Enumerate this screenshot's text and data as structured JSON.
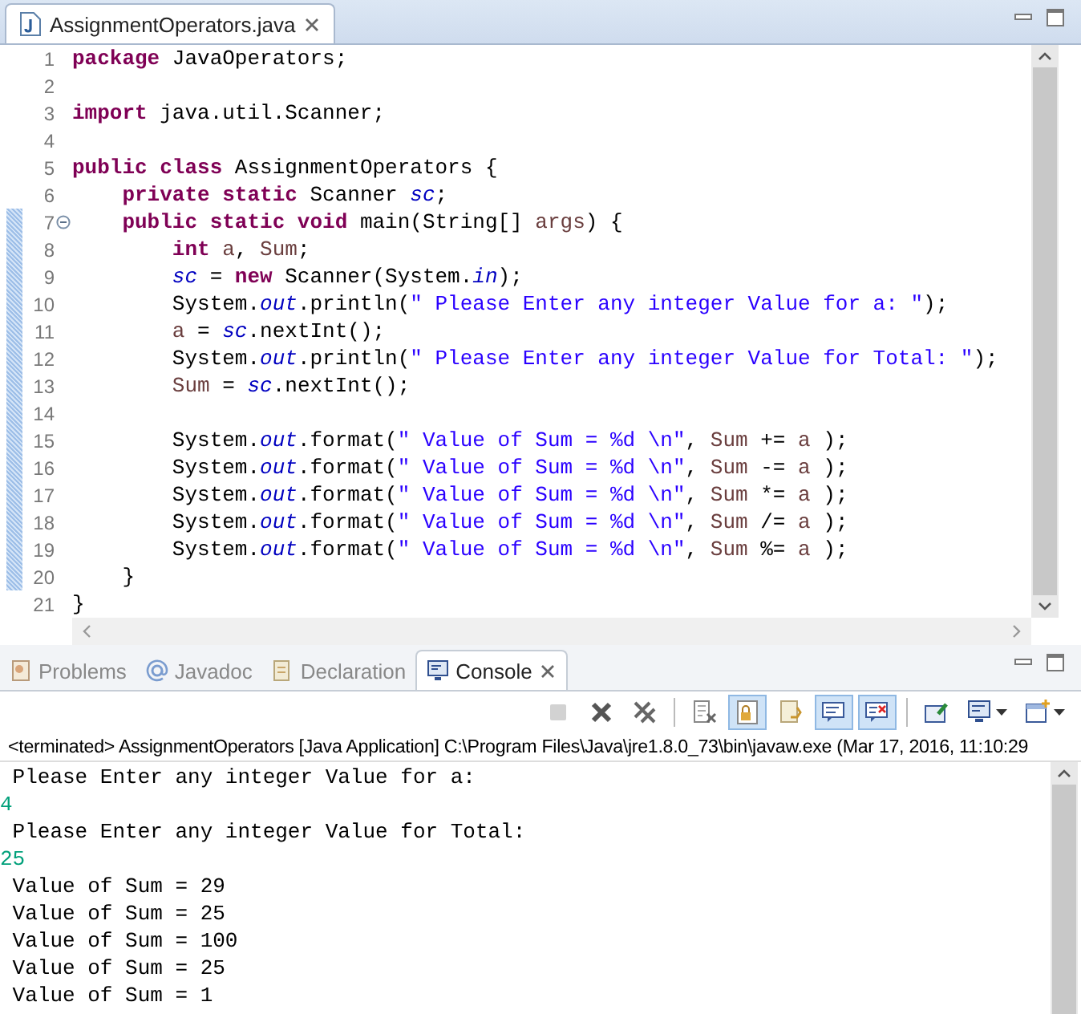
{
  "editor": {
    "tab": {
      "label": "AssignmentOperators.java",
      "selected": true
    },
    "lines": [
      {
        "number": "1",
        "changed": false,
        "collapsible": false,
        "tokens": [
          {
            "kind": "keyword",
            "text": "package"
          },
          {
            "kind": "plain",
            "text": " JavaOperators;"
          }
        ]
      },
      {
        "number": "2",
        "changed": false,
        "collapsible": false
      },
      {
        "number": "3",
        "changed": false,
        "collapsible": false,
        "tokens": [
          {
            "kind": "keyword",
            "text": "import"
          },
          {
            "kind": "plain",
            "text": " java.util.Scanner;"
          }
        ]
      },
      {
        "number": "4",
        "changed": false,
        "collapsible": false
      },
      {
        "number": "5",
        "changed": false,
        "collapsible": false,
        "tokens": [
          {
            "kind": "keyword",
            "text": "public class"
          },
          {
            "kind": "plain",
            "text": " AssignmentOperators {"
          }
        ]
      },
      {
        "number": "6",
        "changed": false,
        "collapsible": false,
        "tokens": [
          {
            "kind": "keyword",
            "text": "    private static"
          },
          {
            "kind": "plain",
            "text": " Scanner "
          },
          {
            "kind": "field",
            "text": "sc"
          },
          {
            "kind": "plain",
            "text": ";"
          }
        ]
      },
      {
        "number": "7",
        "changed": true,
        "collapsible": true,
        "tokens": [
          {
            "kind": "keyword",
            "text": "    public static void"
          },
          {
            "kind": "plain",
            "text": " main(String[] "
          },
          {
            "kind": "variable",
            "text": "args"
          },
          {
            "kind": "plain",
            "text": ") {"
          }
        ]
      },
      {
        "number": "8",
        "changed": true,
        "collapsible": false,
        "tokens": [
          {
            "kind": "keyword",
            "text": "        int"
          },
          {
            "kind": "variable",
            "text": " a"
          },
          {
            "kind": "plain",
            "text": ", "
          },
          {
            "kind": "variable",
            "text": "Sum"
          },
          {
            "kind": "plain",
            "text": ";"
          }
        ]
      },
      {
        "number": "9",
        "changed": true,
        "collapsible": false,
        "tokens": [
          {
            "kind": "field",
            "text": "        sc"
          },
          {
            "kind": "plain",
            "text": " = "
          },
          {
            "kind": "keyword",
            "text": "new"
          },
          {
            "kind": "plain",
            "text": " Scanner(System."
          },
          {
            "kind": "field",
            "text": "in"
          },
          {
            "kind": "plain",
            "text": ");"
          }
        ]
      },
      {
        "number": "10",
        "changed": true,
        "collapsible": false,
        "tokens": [
          {
            "kind": "plain",
            "text": "        System."
          },
          {
            "kind": "field",
            "text": "out"
          },
          {
            "kind": "plain",
            "text": ".println("
          },
          {
            "kind": "string",
            "text": "\" Please Enter any integer Value for a: \""
          },
          {
            "kind": "plain",
            "text": ");"
          }
        ]
      },
      {
        "number": "11",
        "changed": true,
        "collapsible": false,
        "tokens": [
          {
            "kind": "variable",
            "text": "        a"
          },
          {
            "kind": "plain",
            "text": " = "
          },
          {
            "kind": "field",
            "text": "sc"
          },
          {
            "kind": "plain",
            "text": ".nextInt();"
          }
        ]
      },
      {
        "number": "12",
        "changed": true,
        "collapsible": false,
        "tokens": [
          {
            "kind": "plain",
            "text": "        System."
          },
          {
            "kind": "field",
            "text": "out"
          },
          {
            "kind": "plain",
            "text": ".println("
          },
          {
            "kind": "string",
            "text": "\" Please Enter any integer Value for Total: \""
          },
          {
            "kind": "plain",
            "text": ");"
          }
        ]
      },
      {
        "number": "13",
        "changed": true,
        "collapsible": false,
        "tokens": [
          {
            "kind": "variable",
            "text": "        Sum"
          },
          {
            "kind": "plain",
            "text": " = "
          },
          {
            "kind": "field",
            "text": "sc"
          },
          {
            "kind": "plain",
            "text": ".nextInt();"
          }
        ]
      },
      {
        "number": "14",
        "changed": true,
        "collapsible": false
      },
      {
        "number": "15",
        "changed": true,
        "collapsible": false,
        "tokens": [
          {
            "kind": "plain",
            "text": "        System."
          },
          {
            "kind": "field",
            "text": "out"
          },
          {
            "kind": "plain",
            "text": ".format("
          },
          {
            "kind": "string",
            "text": "\" Value of Sum = %d \\n\""
          },
          {
            "kind": "plain",
            "text": ", "
          },
          {
            "kind": "variable",
            "text": "Sum"
          },
          {
            "kind": "plain",
            "text": " += "
          },
          {
            "kind": "variable",
            "text": "a"
          },
          {
            "kind": "plain",
            "text": " );"
          }
        ]
      },
      {
        "number": "16",
        "changed": true,
        "collapsible": false,
        "tokens": [
          {
            "kind": "plain",
            "text": "        System."
          },
          {
            "kind": "field",
            "text": "out"
          },
          {
            "kind": "plain",
            "text": ".format("
          },
          {
            "kind": "string",
            "text": "\" Value of Sum = %d \\n\""
          },
          {
            "kind": "plain",
            "text": ", "
          },
          {
            "kind": "variable",
            "text": "Sum"
          },
          {
            "kind": "plain",
            "text": " -= "
          },
          {
            "kind": "variable",
            "text": "a"
          },
          {
            "kind": "plain",
            "text": " );"
          }
        ]
      },
      {
        "number": "17",
        "changed": true,
        "collapsible": false,
        "tokens": [
          {
            "kind": "plain",
            "text": "        System."
          },
          {
            "kind": "field",
            "text": "out"
          },
          {
            "kind": "plain",
            "text": ".format("
          },
          {
            "kind": "string",
            "text": "\" Value of Sum = %d \\n\""
          },
          {
            "kind": "plain",
            "text": ", "
          },
          {
            "kind": "variable",
            "text": "Sum"
          },
          {
            "kind": "plain",
            "text": " *= "
          },
          {
            "kind": "variable",
            "text": "a"
          },
          {
            "kind": "plain",
            "text": " );"
          }
        ]
      },
      {
        "number": "18",
        "changed": true,
        "collapsible": false,
        "tokens": [
          {
            "kind": "plain",
            "text": "        System."
          },
          {
            "kind": "field",
            "text": "out"
          },
          {
            "kind": "plain",
            "text": ".format("
          },
          {
            "kind": "string",
            "text": "\" Value of Sum = %d \\n\""
          },
          {
            "kind": "plain",
            "text": ", "
          },
          {
            "kind": "variable",
            "text": "Sum"
          },
          {
            "kind": "plain",
            "text": " /= "
          },
          {
            "kind": "variable",
            "text": "a"
          },
          {
            "kind": "plain",
            "text": " );"
          }
        ]
      },
      {
        "number": "19",
        "changed": true,
        "collapsible": false,
        "tokens": [
          {
            "kind": "plain",
            "text": "        System."
          },
          {
            "kind": "field",
            "text": "out"
          },
          {
            "kind": "plain",
            "text": ".format("
          },
          {
            "kind": "string",
            "text": "\" Value of Sum = %d \\n\""
          },
          {
            "kind": "plain",
            "text": ", "
          },
          {
            "kind": "variable",
            "text": "Sum"
          },
          {
            "kind": "plain",
            "text": " %= "
          },
          {
            "kind": "variable",
            "text": "a"
          },
          {
            "kind": "plain",
            "text": " );"
          }
        ]
      },
      {
        "number": "20",
        "changed": true,
        "collapsible": false,
        "tokens": [
          {
            "kind": "plain",
            "text": "    }"
          }
        ]
      },
      {
        "number": "21",
        "changed": false,
        "collapsible": false,
        "tokens": [
          {
            "kind": "plain",
            "text": "}"
          }
        ]
      }
    ]
  },
  "panel": {
    "tabs": [
      {
        "kind": "problems",
        "label": "Problems",
        "selected": false
      },
      {
        "kind": "javadoc",
        "label": "Javadoc",
        "selected": false
      },
      {
        "kind": "declaration",
        "label": "Declaration",
        "selected": false
      },
      {
        "kind": "console",
        "label": "Console",
        "selected": true
      }
    ],
    "toolbar": [
      {
        "kind": "terminate",
        "selected": false,
        "disabled": true
      },
      {
        "kind": "remove",
        "selected": false,
        "disabled": false
      },
      {
        "kind": "remove-all",
        "selected": false,
        "disabled": false
      },
      {
        "kind": "clear",
        "selected": false,
        "disabled": false
      },
      {
        "kind": "scroll-lock",
        "selected": true,
        "disabled": false
      },
      {
        "kind": "word-wrap",
        "selected": false,
        "disabled": false
      },
      {
        "kind": "show-out",
        "selected": true,
        "disabled": false
      },
      {
        "kind": "show-err",
        "selected": true,
        "disabled": false
      },
      {
        "kind": "pin",
        "selected": false,
        "disabled": false
      },
      {
        "kind": "display",
        "selected": false,
        "disabled": false
      },
      {
        "kind": "open",
        "selected": false,
        "disabled": false
      }
    ],
    "status": "<terminated> AssignmentOperators [Java Application] C:\\Program Files\\Java\\jre1.8.0_73\\bin\\javaw.exe (Mar 17, 2016, 11:10:29",
    "output": [
      {
        "kind": "output",
        "text": " Please Enter any integer Value for a:"
      },
      {
        "kind": "input",
        "text": "4"
      },
      {
        "kind": "output",
        "text": " Please Enter any integer Value for Total:"
      },
      {
        "kind": "input",
        "text": "25"
      },
      {
        "kind": "output",
        "text": " Value of Sum = 29"
      },
      {
        "kind": "output",
        "text": " Value of Sum = 25"
      },
      {
        "kind": "output",
        "text": " Value of Sum = 100"
      },
      {
        "kind": "output",
        "text": " Value of Sum = 25"
      },
      {
        "kind": "output",
        "text": " Value of Sum = 1"
      }
    ]
  }
}
